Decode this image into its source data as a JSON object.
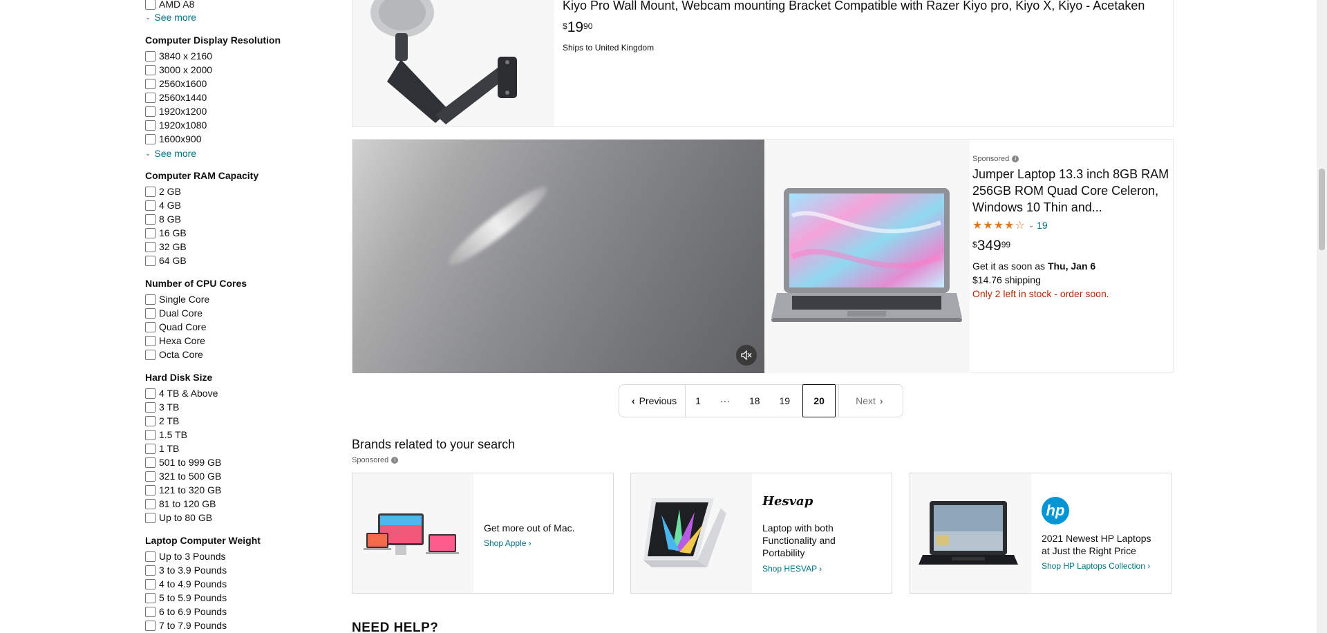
{
  "sidebar": {
    "top_items": [
      {
        "label": "AMD A8"
      }
    ],
    "see_more_1": "See more",
    "resolution": {
      "title": "Computer Display Resolution",
      "items": [
        "3840 x 2160",
        "3000 x 2000",
        "2560x1600",
        "2560x1440",
        "1920x1200",
        "1920x1080",
        "1600x900"
      ],
      "see_more": "See more"
    },
    "ram": {
      "title": "Computer RAM Capacity",
      "items": [
        "2 GB",
        "4 GB",
        "8 GB",
        "16 GB",
        "32 GB",
        "64 GB"
      ]
    },
    "cpu": {
      "title": "Number of CPU Cores",
      "items": [
        "Single Core",
        "Dual Core",
        "Quad Core",
        "Hexa Core",
        "Octa Core"
      ]
    },
    "disk": {
      "title": "Hard Disk Size",
      "items": [
        "4 TB & Above",
        "3 TB",
        "2 TB",
        "1.5 TB",
        "1 TB",
        "501 to 999 GB",
        "321 to 500 GB",
        "121 to 320 GB",
        "81 to 120 GB",
        "Up to 80 GB"
      ]
    },
    "weight": {
      "title": "Laptop Computer Weight",
      "items": [
        "Up to 3 Pounds",
        "3 to 3.9 Pounds",
        "4 to 4.9 Pounds",
        "5 to 5.9 Pounds",
        "6 to 6.9 Pounds",
        "7 to 7.9 Pounds"
      ]
    }
  },
  "kiyo": {
    "title": "Kiyo Pro Wall Mount, Webcam mounting Bracket Compatible with Razer Kiyo pro, Kiyo X, Kiyo - Acetaken",
    "price_symbol": "$",
    "price_whole": "19",
    "price_fraction": "90",
    "shipping": "Ships to United Kingdom"
  },
  "jumper": {
    "sponsored": "Sponsored",
    "title": "Jumper Laptop 13.3 inch 8GB RAM 256GB ROM Quad Core Celeron, Windows 10 Thin and...",
    "rating": 3.5,
    "stars": "★★★★☆",
    "rating_count": "19",
    "price_symbol": "$",
    "price_whole": "349",
    "price_fraction": "99",
    "delivery_prefix": "Get it as soon as ",
    "delivery_date": "Thu, Jan 6",
    "shipping": "$14.76 shipping",
    "stock": "Only 2 left in stock - order soon."
  },
  "pagination": {
    "previous": "Previous",
    "pages": [
      "1",
      "···",
      "18",
      "19"
    ],
    "current": "20",
    "next": "Next"
  },
  "brands": {
    "title": "Brands related to your search",
    "sponsored": "Sponsored",
    "cards": [
      {
        "text": "Get more out of Mac.",
        "link": "Shop Apple ›"
      },
      {
        "logo": "Hesvap",
        "text": "Laptop with both Functionality and Portability",
        "link": "Shop HESVAP ›"
      },
      {
        "logo": "hp",
        "text": "2021 Newest HP Laptops at Just the Right Price",
        "link": "Shop HP Laptops Collection ›"
      }
    ]
  },
  "need_help": "NEED HELP?",
  "colors": {
    "link": "#007185",
    "stock_red": "#b12704",
    "star": "#de7921",
    "hp_blue": "#0096d6"
  }
}
